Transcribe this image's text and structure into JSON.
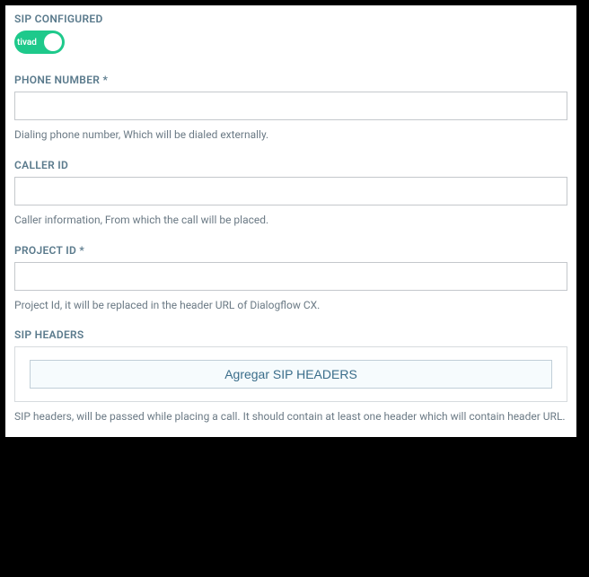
{
  "sipConfigured": {
    "label": "SIP CONFIGURED",
    "toggleText": "tivad"
  },
  "phoneNumber": {
    "label": "PHONE NUMBER *",
    "value": "",
    "help": "Dialing phone number, Which will be dialed externally."
  },
  "callerId": {
    "label": "CALLER ID",
    "value": "",
    "help": "Caller information, From which the call will be placed."
  },
  "projectId": {
    "label": "PROJECT ID *",
    "value": "",
    "help": "Project Id, it will be replaced in the header URL of Dialogflow CX."
  },
  "sipHeaders": {
    "label": "SIP HEADERS",
    "buttonLabel": "Agregar SIP HEADERS",
    "help": "SIP headers, will be passed while placing a call. It should contain at least one header which will contain header URL."
  }
}
